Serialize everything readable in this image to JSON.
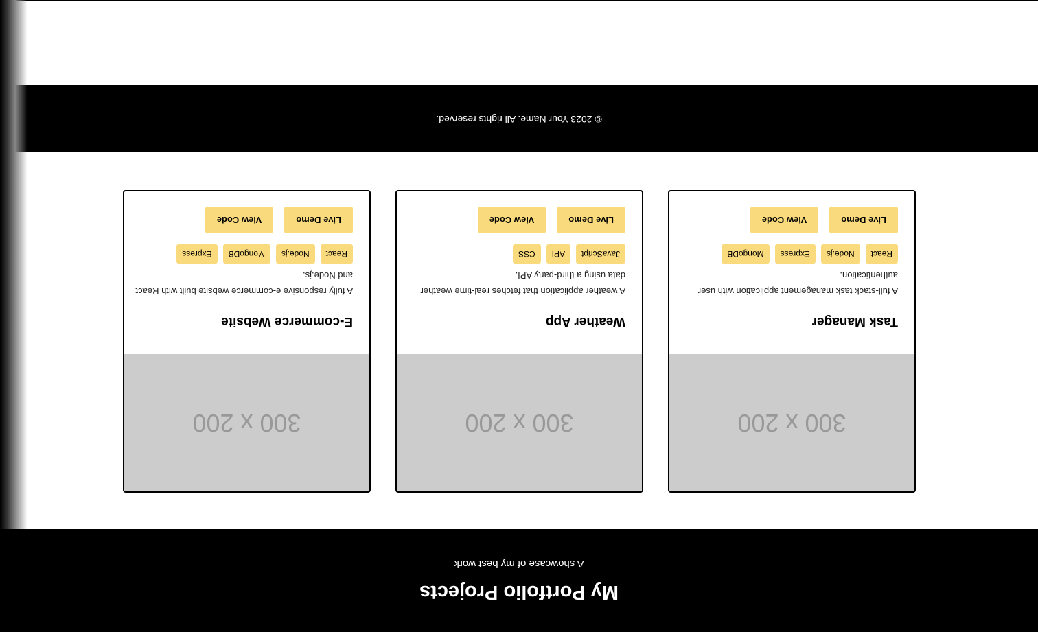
{
  "header": {
    "title": "My Portfolio Projects",
    "subtitle": "A showcase of my best work"
  },
  "projects": [
    {
      "image_placeholder": "300 x 200",
      "title": "Task Manager",
      "description": "A full-stack task management application with user authentication.",
      "tags": [
        "React",
        "Node.js",
        "Express",
        "MongoDB"
      ],
      "live_demo_label": "Live Demo",
      "view_code_label": "View Code"
    },
    {
      "image_placeholder": "300 x 200",
      "title": "Weather App",
      "description": "A weather application that fetches real-time weather data using a third-party API.",
      "tags": [
        "JavaScript",
        "API",
        "CSS"
      ],
      "live_demo_label": "Live Demo",
      "view_code_label": "View Code"
    },
    {
      "image_placeholder": "300 x 200",
      "title": "E-commerce Website",
      "description": "A fully responsive e-commerce website built with React and Node.js.",
      "tags": [
        "React",
        "Node.js",
        "MongoDB",
        "Express"
      ],
      "live_demo_label": "Live Demo",
      "view_code_label": "View Code"
    }
  ],
  "footer": {
    "copyright": "© 2023 Your Name. All rights reserved."
  },
  "colors": {
    "header_bg": "#000000",
    "accent": "#f9da7c",
    "placeholder_bg": "#cccccc",
    "placeholder_text": "#999999"
  },
  "orientation": "rotated-180"
}
